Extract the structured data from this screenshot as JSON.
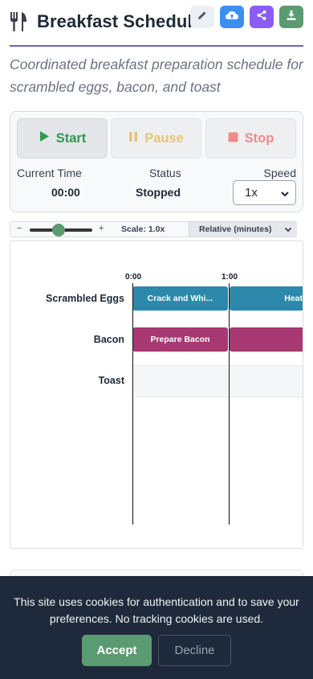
{
  "header": {
    "title": "Breakfast Schedule",
    "toolbar": {
      "edit_icon": "pencil-icon",
      "cloud_icon": "cloud-upload-icon",
      "share_icon": "share-icon",
      "download_icon": "download-icon",
      "colors": {
        "cloud": "#3b8ff0",
        "share": "#8b5cf6",
        "download": "#5b9b72"
      }
    }
  },
  "subtitle": "Coordinated breakfast preparation schedule for scrambled eggs, bacon, and toast",
  "controls": {
    "start_label": "Start",
    "pause_label": "Pause",
    "stop_label": "Stop",
    "current_time_label": "Current Time",
    "current_time_value": "00:00",
    "status_label": "Status",
    "status_value": "Stopped",
    "speed_label": "Speed",
    "speed_value": "1x"
  },
  "scale_bar": {
    "minus": "−",
    "plus": "+",
    "scale_text": "Scale: 1.0x",
    "mode": "Relative (minutes)",
    "zoom_level": 0.45
  },
  "timeline": {
    "ticks": [
      "0:00",
      "1:00"
    ],
    "rows": [
      {
        "label": "Scrambled Eggs",
        "tasks": [
          "Crack and Whi...",
          "Heat"
        ]
      },
      {
        "label": "Bacon",
        "tasks": [
          "Prepare Bacon",
          ""
        ]
      },
      {
        "label": "Toast",
        "tasks": []
      }
    ],
    "colors": {
      "eggs": "#2c89ab",
      "bacon": "#a83872"
    }
  },
  "cookie_banner": {
    "text": "This site uses cookies for authentication and to save your preferences. No tracking cookies are used.",
    "accept_label": "Accept",
    "decline_label": "Decline"
  }
}
